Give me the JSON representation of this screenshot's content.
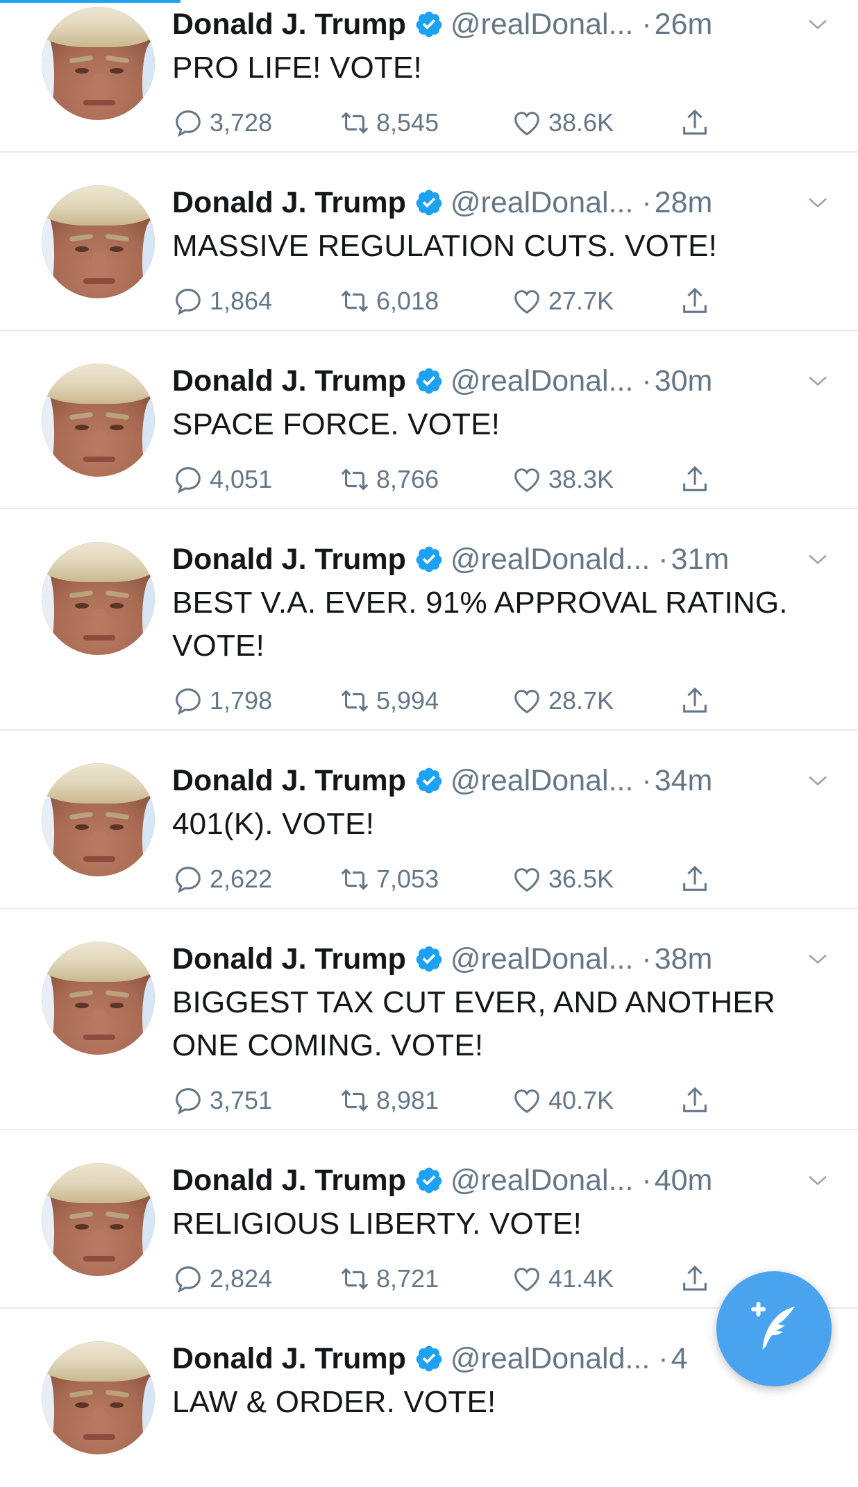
{
  "theme": {
    "accent": "#1da1f2",
    "verified_blue": "#1da1f2",
    "muted": "#657786",
    "text": "#14171a",
    "divider": "#e6ecf0",
    "fab": "#4aa3ee"
  },
  "tweets": [
    {
      "name": "Donald J. Trump",
      "handle": "@realDonal...",
      "dot": "·",
      "time": "26m",
      "text": "PRO LIFE! VOTE!",
      "replies": "3,728",
      "retweets": "8,545",
      "likes": "38.6K"
    },
    {
      "name": "Donald J. Trump",
      "handle": "@realDonal...",
      "dot": "·",
      "time": "28m",
      "text": "MASSIVE REGULATION CUTS. VOTE!",
      "replies": "1,864",
      "retweets": "6,018",
      "likes": "27.7K"
    },
    {
      "name": "Donald J. Trump",
      "handle": "@realDonal...",
      "dot": "·",
      "time": "30m",
      "text": "SPACE FORCE. VOTE!",
      "replies": "4,051",
      "retweets": "8,766",
      "likes": "38.3K"
    },
    {
      "name": "Donald J. Trump",
      "handle": "@realDonald...",
      "dot": "·",
      "time": "31m",
      "text": "BEST V.A. EVER. 91% APPROVAL RATING. VOTE!",
      "replies": "1,798",
      "retweets": "5,994",
      "likes": "28.7K"
    },
    {
      "name": "Donald J. Trump",
      "handle": "@realDonal...",
      "dot": "·",
      "time": "34m",
      "text": "401(K). VOTE!",
      "replies": "2,622",
      "retweets": "7,053",
      "likes": "36.5K"
    },
    {
      "name": "Donald J. Trump",
      "handle": "@realDonal...",
      "dot": "·",
      "time": "38m",
      "text": "BIGGEST TAX CUT EVER, AND ANOTHER ONE COMING. VOTE!",
      "replies": "3,751",
      "retweets": "8,981",
      "likes": "40.7K"
    },
    {
      "name": "Donald J. Trump",
      "handle": "@realDonal...",
      "dot": "·",
      "time": "40m",
      "text": "RELIGIOUS LIBERTY. VOTE!",
      "replies": "2,824",
      "retweets": "8,721",
      "likes": "41.4K"
    },
    {
      "name": "Donald J. Trump",
      "handle": "@realDonald...",
      "dot": "·",
      "time": "4",
      "text": "LAW & ORDER. VOTE!",
      "replies": "",
      "retweets": "",
      "likes": ""
    }
  ],
  "icons": {
    "reply": "reply-icon",
    "retweet": "retweet-icon",
    "like": "heart-icon",
    "share": "share-icon",
    "verified": "verified-badge-icon",
    "menu": "chevron-down-icon",
    "compose": "compose-tweet-icon"
  }
}
